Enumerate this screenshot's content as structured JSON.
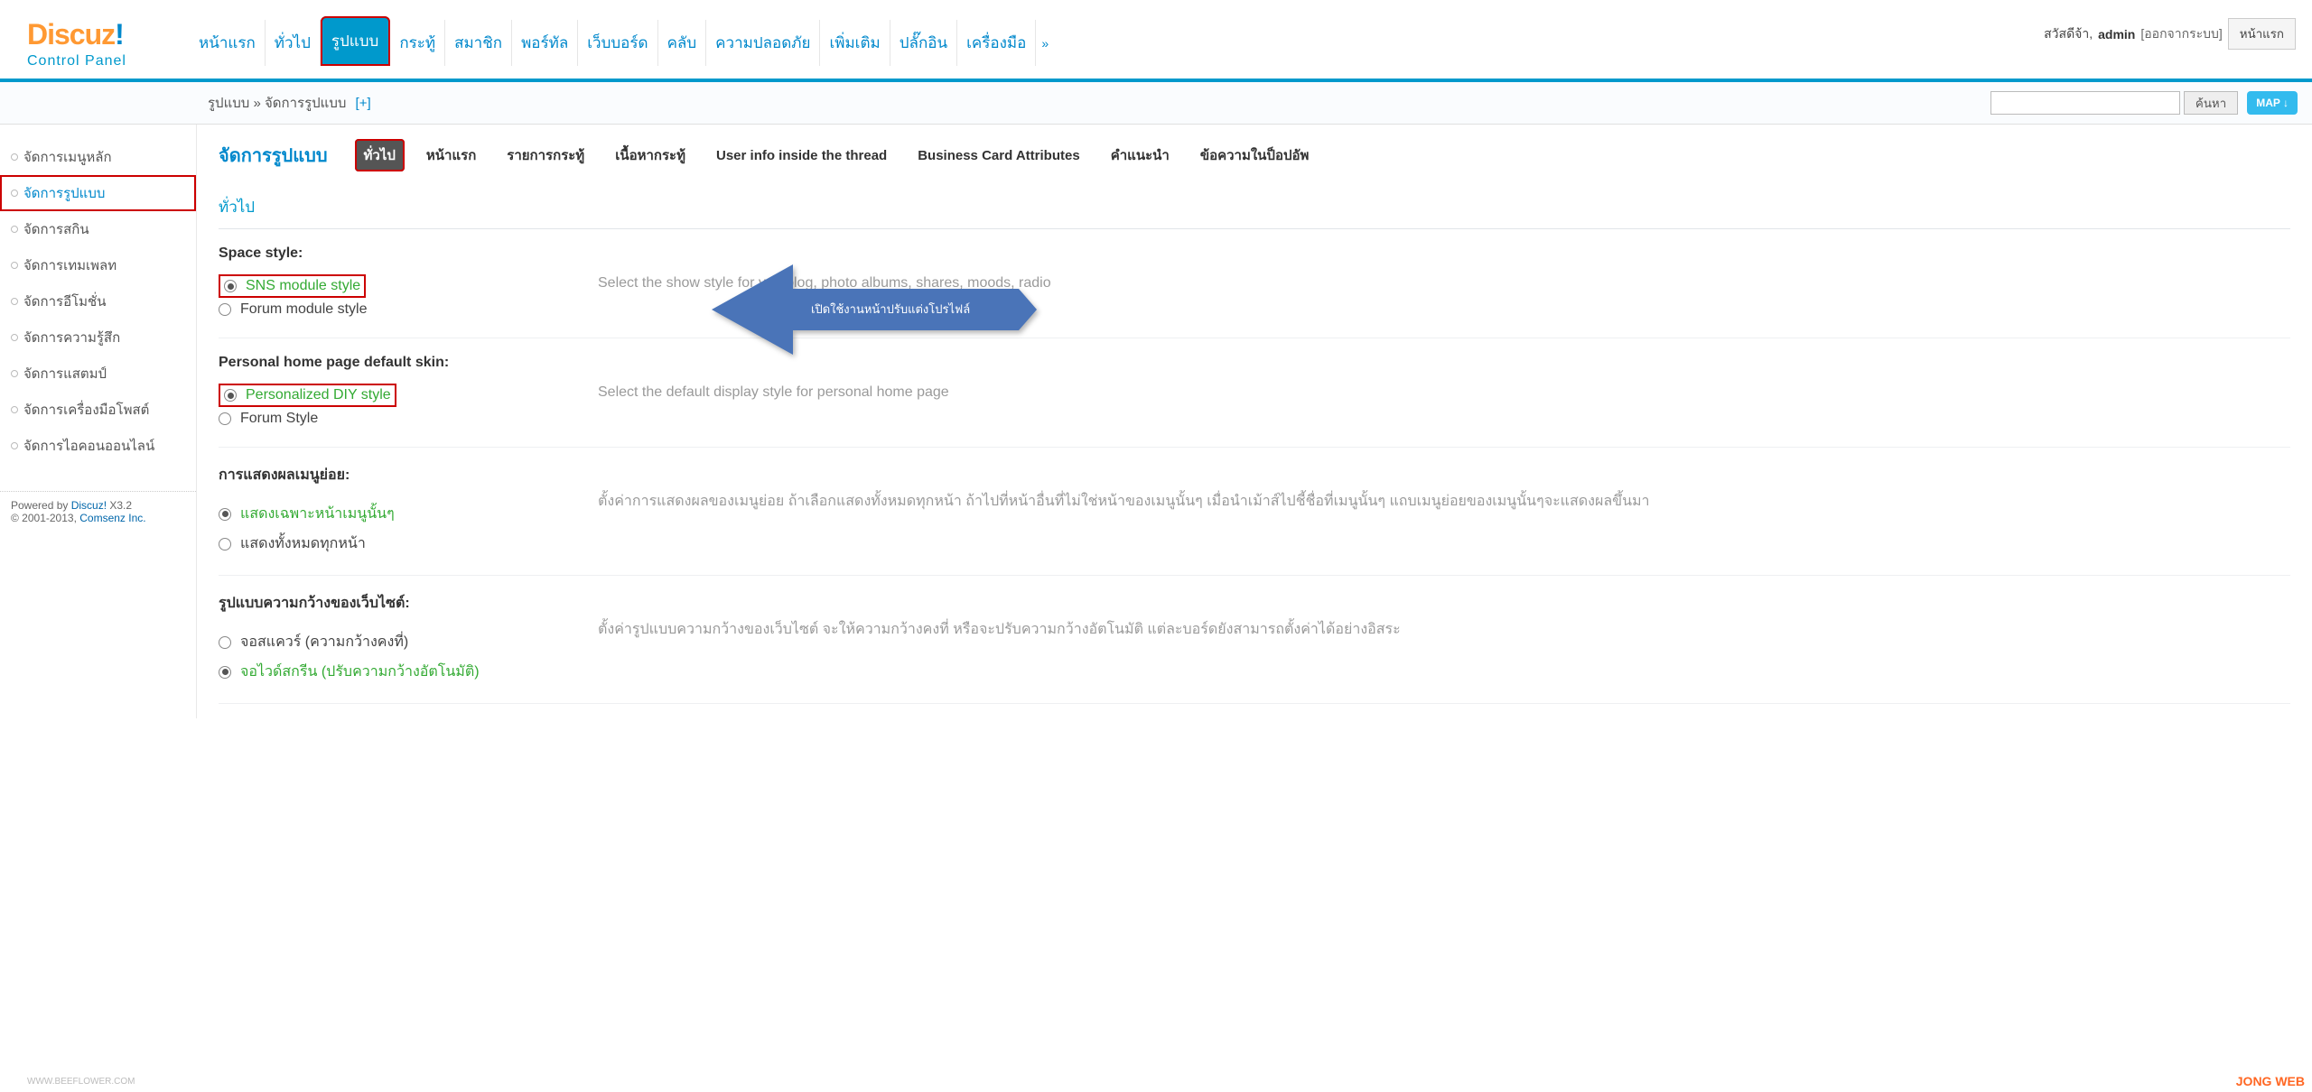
{
  "logo": {
    "main": "Discuz",
    "excl": "!",
    "sub": "Control Panel"
  },
  "topnav": {
    "items": [
      {
        "label": "หน้าแรก",
        "active": false
      },
      {
        "label": "ทั่วไป",
        "active": false
      },
      {
        "label": "รูปแบบ",
        "active": true,
        "highlighted": true
      },
      {
        "label": "กระทู้",
        "active": false
      },
      {
        "label": "สมาชิก",
        "active": false
      },
      {
        "label": "พอร์ทัล",
        "active": false
      },
      {
        "label": "เว็บบอร์ด",
        "active": false
      },
      {
        "label": "คลับ",
        "active": false
      },
      {
        "label": "ความปลอดภัย",
        "active": false
      },
      {
        "label": "เพิ่มเติม",
        "active": false
      },
      {
        "label": "ปลั๊กอิน",
        "active": false
      },
      {
        "label": "เครื่องมือ",
        "active": false
      }
    ],
    "more": "»"
  },
  "user": {
    "hello": "สวัสดีจ้า,",
    "name": "admin",
    "logout": "[ออกจากระบบ]",
    "front": "หน้าแรก"
  },
  "breadcrumb": {
    "a": "รูปแบบ",
    "sep": " » ",
    "b": "จัดการรูปแบบ",
    "plus": "[+]"
  },
  "search": {
    "btn": "ค้นหา",
    "map": "MAP ↓"
  },
  "sidebar": {
    "items": [
      {
        "label": "จัดการเมนูหลัก"
      },
      {
        "label": "จัดการรูปแบบ",
        "active": true,
        "highlighted": true
      },
      {
        "label": "จัดการสกิน"
      },
      {
        "label": "จัดการเทมเพลท"
      },
      {
        "label": "จัดการอีโมชั่น"
      },
      {
        "label": "จัดการความรู้สึก"
      },
      {
        "label": "จัดการแสตมป์"
      },
      {
        "label": "จัดการเครื่องมือโพสต์"
      },
      {
        "label": "จัดการไอคอนออนไลน์"
      }
    ]
  },
  "footer": {
    "powered": "Powered by ",
    "product": "Discuz!",
    "ver": " X3.2",
    "copyright": "© 2001-2013, ",
    "company": "Comsenz Inc."
  },
  "page": {
    "title": "จัดการรูปแบบ",
    "tabs": [
      {
        "label": "ทั่วไป",
        "active": true,
        "highlighted": true
      },
      {
        "label": "หน้าแรก"
      },
      {
        "label": "รายการกระทู้"
      },
      {
        "label": "เนื้อหากระทู้"
      },
      {
        "label": "User info inside the thread"
      },
      {
        "label": "Business Card Attributes"
      },
      {
        "label": "คำแนะนำ"
      },
      {
        "label": "ข้อความในป็อปอัพ"
      }
    ],
    "section_head": "ทั่วไป"
  },
  "arrow_text": "เปิดใช้งานหน้าปรับแต่งโปรไฟล์",
  "settings": [
    {
      "label": "Space style:",
      "options": [
        {
          "label": "SNS module style",
          "checked": true,
          "green": true,
          "highlighted": true
        },
        {
          "label": "Forum module style",
          "checked": false
        }
      ],
      "desc": "Select the show style for you blog, photo albums, shares, moods, radio"
    },
    {
      "label": "Personal home page default skin:",
      "options": [
        {
          "label": "Personalized DIY style",
          "checked": true,
          "green": true,
          "highlighted": true
        },
        {
          "label": "Forum Style",
          "checked": false
        }
      ],
      "desc": "Select the default display style for personal home page"
    },
    {
      "label": "การแสดงผลเมนูย่อย:",
      "options": [
        {
          "label": "แสดงเฉพาะหน้าเมนูนั้นๆ",
          "checked": true,
          "green": true
        },
        {
          "label": "แสดงทั้งหมดทุกหน้า",
          "checked": false
        }
      ],
      "desc": "ตั้งค่าการแสดงผลของเมนูย่อย ถ้าเลือกแสดงทั้งหมดทุกหน้า ถ้าไปที่หน้าอื่นที่ไม่ใช่หน้าของเมนูนั้นๆ เมื่อนำเม้าส์ไปชี้ชื่อที่เมนูนั้นๆ แถบเมนูย่อยของเมนูนั้นๆจะแสดงผลขึ้นมา"
    },
    {
      "label": "รูปแบบความกว้างของเว็บไซต์:",
      "options": [
        {
          "label": "จอสแควร์ (ความกว้างคงที่)",
          "checked": false
        },
        {
          "label": "จอไวด์สกรีน (ปรับความกว้างอัตโนมัติ)",
          "checked": true,
          "green": true
        }
      ],
      "desc": "ตั้งค่ารูปแบบความกว้างของเว็บไซต์ จะให้ความกว้างคงที่ หรือจะปรับความกว้างอัตโนมัติ แต่ละบอร์ดยังสามารถตั้งค่าได้อย่างอิสระ"
    }
  ],
  "watermarks": {
    "w1": "WWW.BEEFLOWER.COM",
    "w2": "JONG WEB"
  }
}
